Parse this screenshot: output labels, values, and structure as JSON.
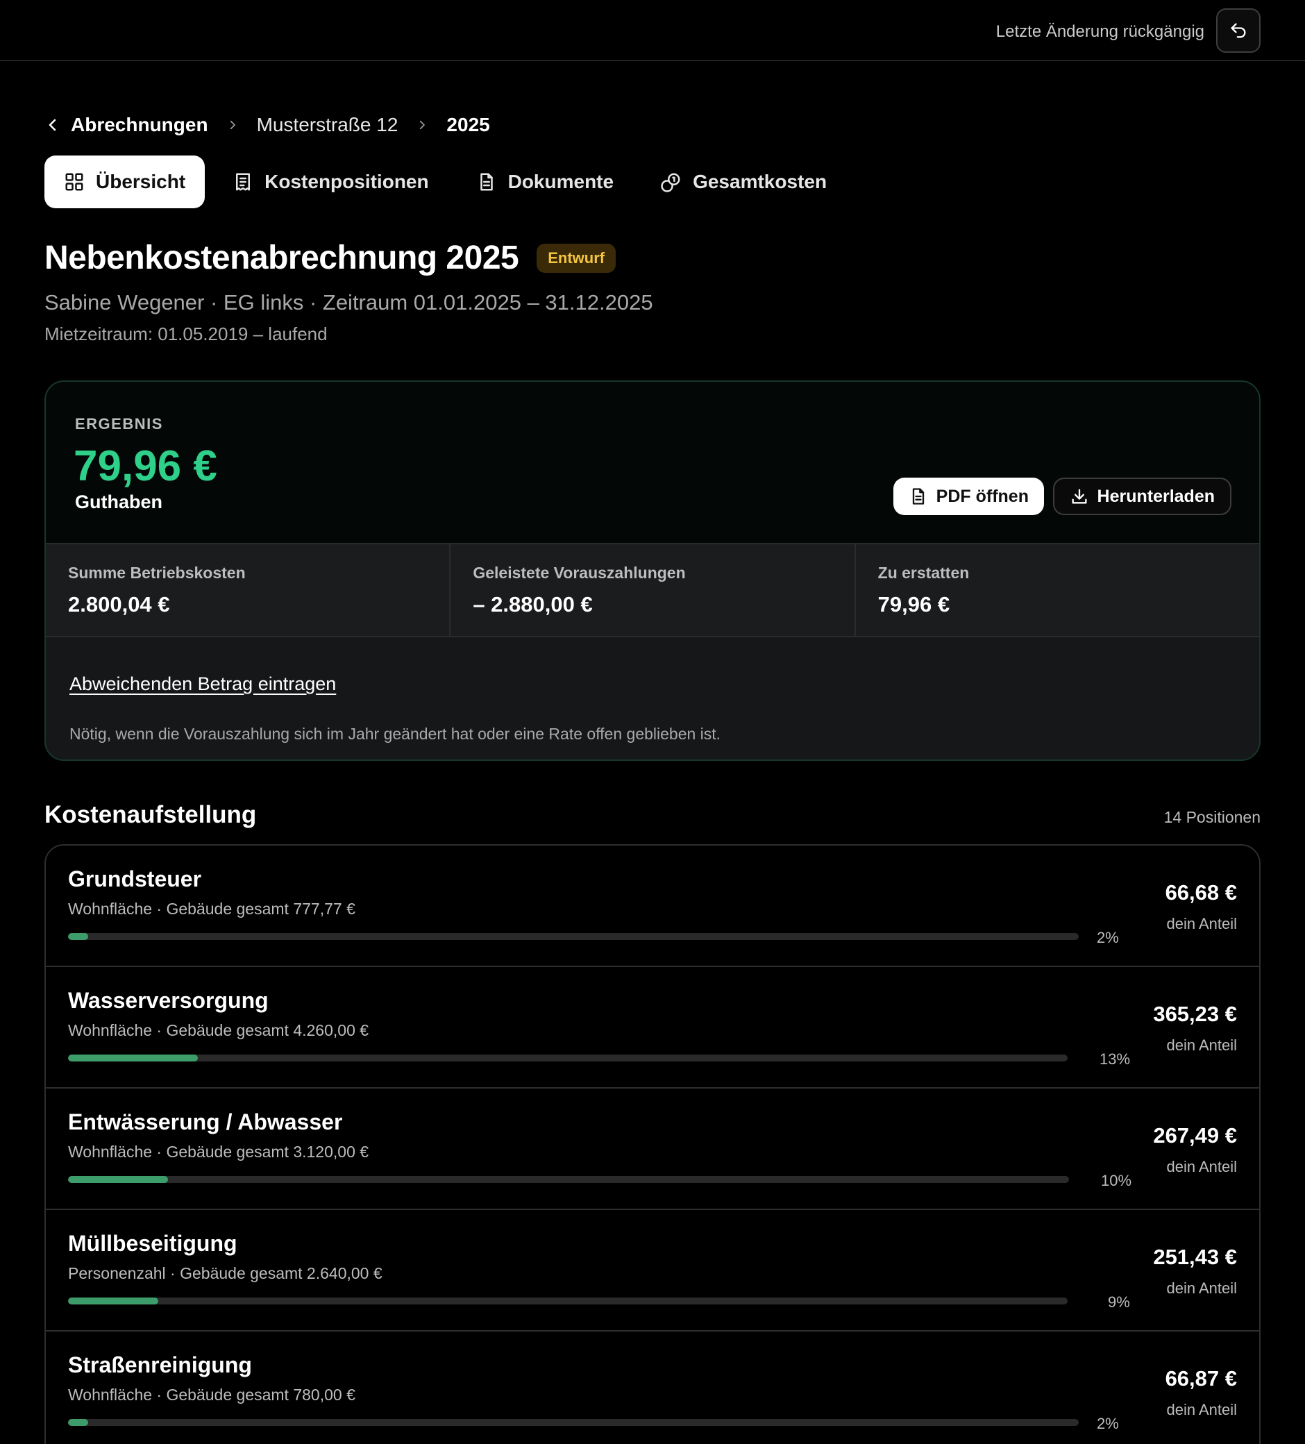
{
  "topbar": {
    "undo_label": "Letzte Änderung rückgängig",
    "undo_icon": "undo-icon"
  },
  "breadcrumb": {
    "back": "Abrechnungen",
    "property": "Musterstraße 12",
    "year": "2025"
  },
  "tabs": [
    {
      "label": "Übersicht",
      "icon": "grid-icon",
      "active": true
    },
    {
      "label": "Kostenpositionen",
      "icon": "receipt-icon",
      "active": false
    },
    {
      "label": "Dokumente",
      "icon": "document-icon",
      "active": false
    },
    {
      "label": "Gesamtkosten",
      "icon": "coins-icon",
      "active": false
    }
  ],
  "header": {
    "title": "Nebenkostenabrechnung 2025",
    "badge": "Entwurf",
    "subtitle": "Sabine Wegener · EG links · Zeitraum 01.01.2025 – 31.12.2025",
    "rental_period": "Mietzeitraum: 01.05.2019 – laufend"
  },
  "result": {
    "label": "ERGEBNIS",
    "amount": "79,96 €",
    "status": "Guthaben",
    "pdf_button": "PDF öffnen",
    "download_button": "Herunterladen",
    "stats": [
      {
        "label": "Summe Betriebskosten",
        "value": "2.800,04 €"
      },
      {
        "label": "Geleistete Vorauszahlungen",
        "value": "– 2.880,00 €"
      },
      {
        "label": "Zu erstatten",
        "value": "79,96 €"
      }
    ],
    "deviate_link": "Abweichenden Betrag eintragen",
    "deviate_hint": "Nötig, wenn die Vorauszahlung sich im Jahr geändert hat oder eine Rate offen geblieben ist."
  },
  "costs": {
    "title": "Kostenaufstellung",
    "count": "14 Positionen",
    "share_label": "dein Anteil",
    "items": [
      {
        "name": "Grundsteuer",
        "meta": "Wohnfläche · Gebäude gesamt 777,77 €",
        "percent_label": "2%",
        "percent": 2,
        "amount": "66,68 €"
      },
      {
        "name": "Wasserversorgung",
        "meta": "Wohnfläche · Gebäude gesamt 4.260,00 €",
        "percent_label": "13%",
        "percent": 13,
        "amount": "365,23 €"
      },
      {
        "name": "Entwässerung / Abwasser",
        "meta": "Wohnfläche · Gebäude gesamt 3.120,00 €",
        "percent_label": "10%",
        "percent": 10,
        "amount": "267,49 €"
      },
      {
        "name": "Müllbeseitigung",
        "meta": "Personenzahl · Gebäude gesamt 2.640,00 €",
        "percent_label": "9%",
        "percent": 9,
        "amount": "251,43 €"
      },
      {
        "name": "Straßenreinigung",
        "meta": "Wohnfläche · Gebäude gesamt 780,00 €",
        "percent_label": "2%",
        "percent": 2,
        "amount": "66,87 €"
      }
    ]
  },
  "colors": {
    "accent_green": "#2fd08a",
    "bar_green": "#3c9d6a",
    "badge_text": "#f5c542",
    "badge_bg": "#3a2a08"
  }
}
